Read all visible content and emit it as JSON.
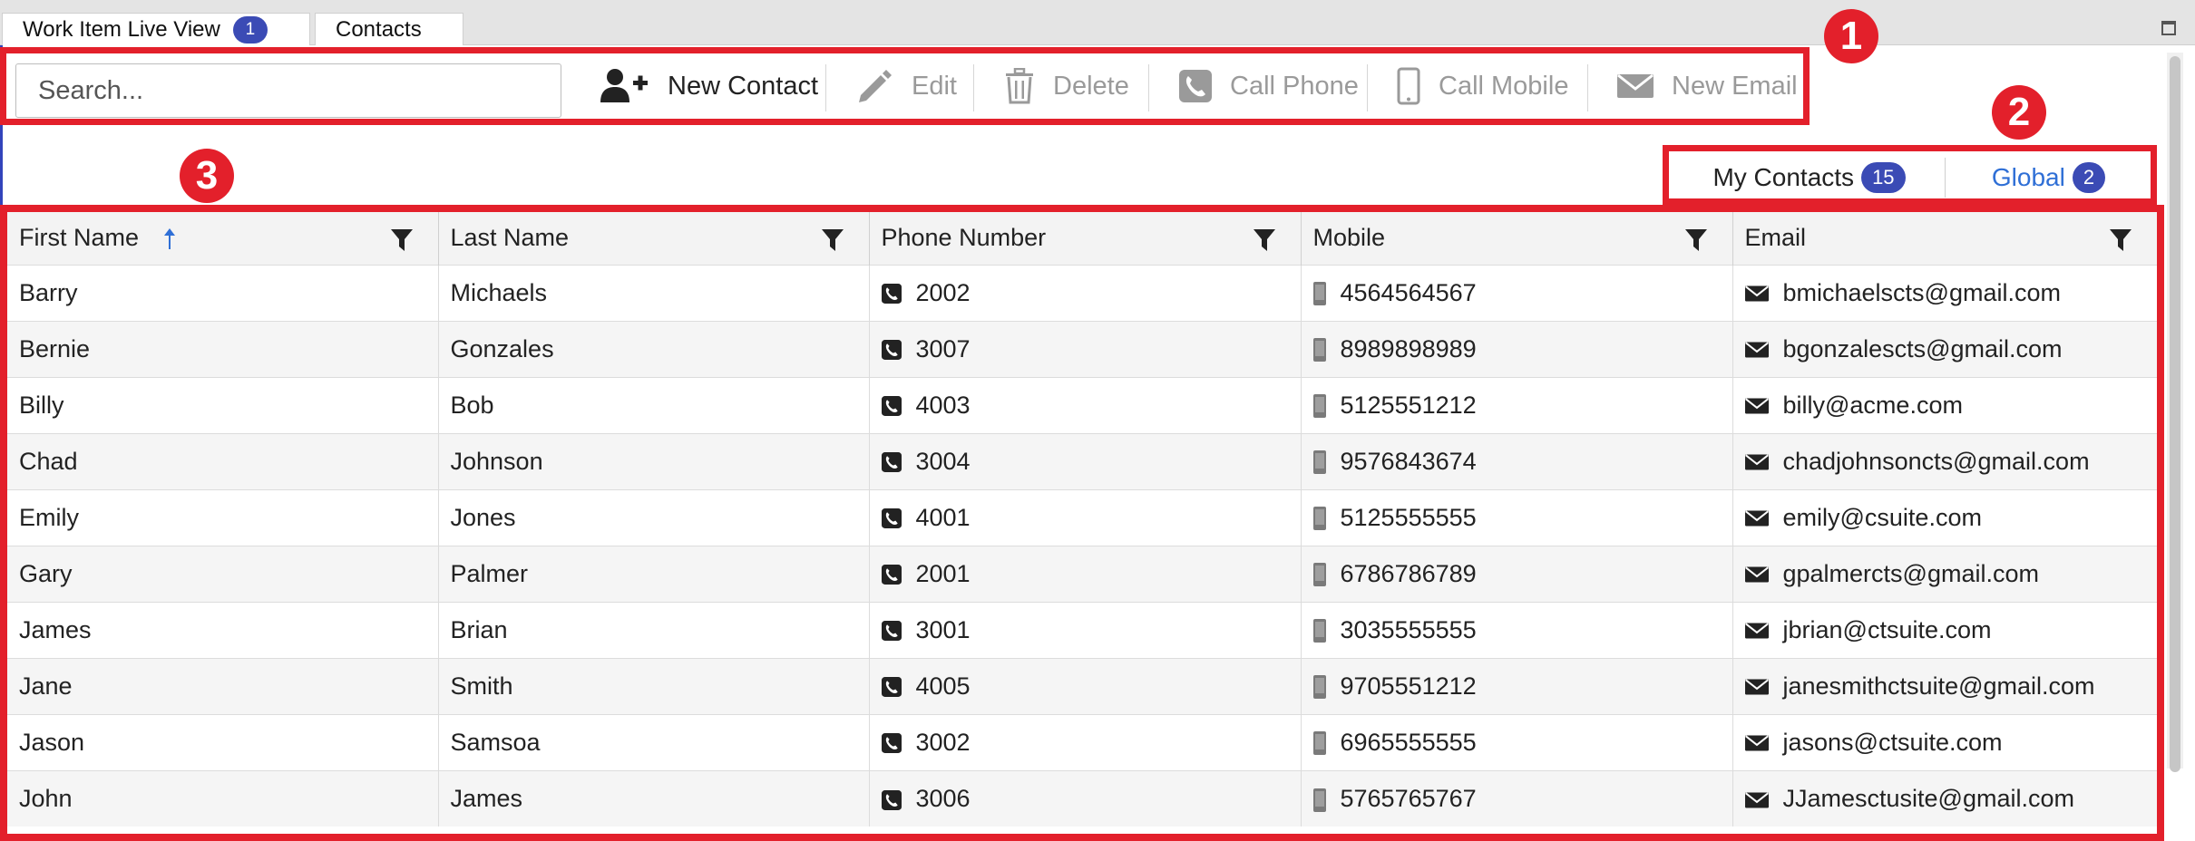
{
  "window_tabs": [
    {
      "label": "Work Item Live View",
      "count": "1"
    },
    {
      "label": "Contacts"
    }
  ],
  "toolbar": {
    "search_placeholder": "Search...",
    "new_contact": "New Contact",
    "edit": "Edit",
    "delete": "Delete",
    "call_phone": "Call Phone",
    "call_mobile": "Call Mobile",
    "new_email": "New Email"
  },
  "filter_tabs": {
    "my_contacts": {
      "label": "My Contacts",
      "count": "15"
    },
    "global": {
      "label": "Global",
      "count": "2"
    }
  },
  "callouts": [
    "1",
    "2",
    "3"
  ],
  "grid": {
    "columns": [
      "First Name",
      "Last Name",
      "Phone Number",
      "Mobile",
      "Email"
    ],
    "sorted_column": "First Name",
    "sort_direction": "ascending",
    "rows": [
      {
        "first": "Barry",
        "last": "Michaels",
        "phone": "2002",
        "mobile": "4564564567",
        "email": "bmichaelscts@gmail.com"
      },
      {
        "first": "Bernie",
        "last": "Gonzales",
        "phone": "3007",
        "mobile": "8989898989",
        "email": "bgonzalescts@gmail.com"
      },
      {
        "first": "Billy",
        "last": "Bob",
        "phone": "4003",
        "mobile": "5125551212",
        "email": "billy@acme.com"
      },
      {
        "first": "Chad",
        "last": "Johnson",
        "phone": "3004",
        "mobile": "9576843674",
        "email": "chadjohnsoncts@gmail.com"
      },
      {
        "first": "Emily",
        "last": "Jones",
        "phone": "4001",
        "mobile": "5125555555",
        "email": "emily@csuite.com"
      },
      {
        "first": "Gary",
        "last": "Palmer",
        "phone": "2001",
        "mobile": "6786786789",
        "email": "gpalmercts@gmail.com"
      },
      {
        "first": "James",
        "last": "Brian",
        "phone": "3001",
        "mobile": "3035555555",
        "email": "jbrian@ctsuite.com"
      },
      {
        "first": "Jane",
        "last": "Smith",
        "phone": "4005",
        "mobile": "9705551212",
        "email": "janesmithctsuite@gmail.com"
      },
      {
        "first": "Jason",
        "last": "Samsoa",
        "phone": "3002",
        "mobile": "6965555555",
        "email": "jasons@ctsuite.com"
      },
      {
        "first": "John",
        "last": "James",
        "phone": "3006",
        "mobile": "5765765767",
        "email": "JJamesctusite@gmail.com"
      }
    ]
  },
  "colors": {
    "annotation_red": "#e3202b",
    "badge_blue": "#3b4bb5",
    "link_blue": "#2f6fd6"
  }
}
